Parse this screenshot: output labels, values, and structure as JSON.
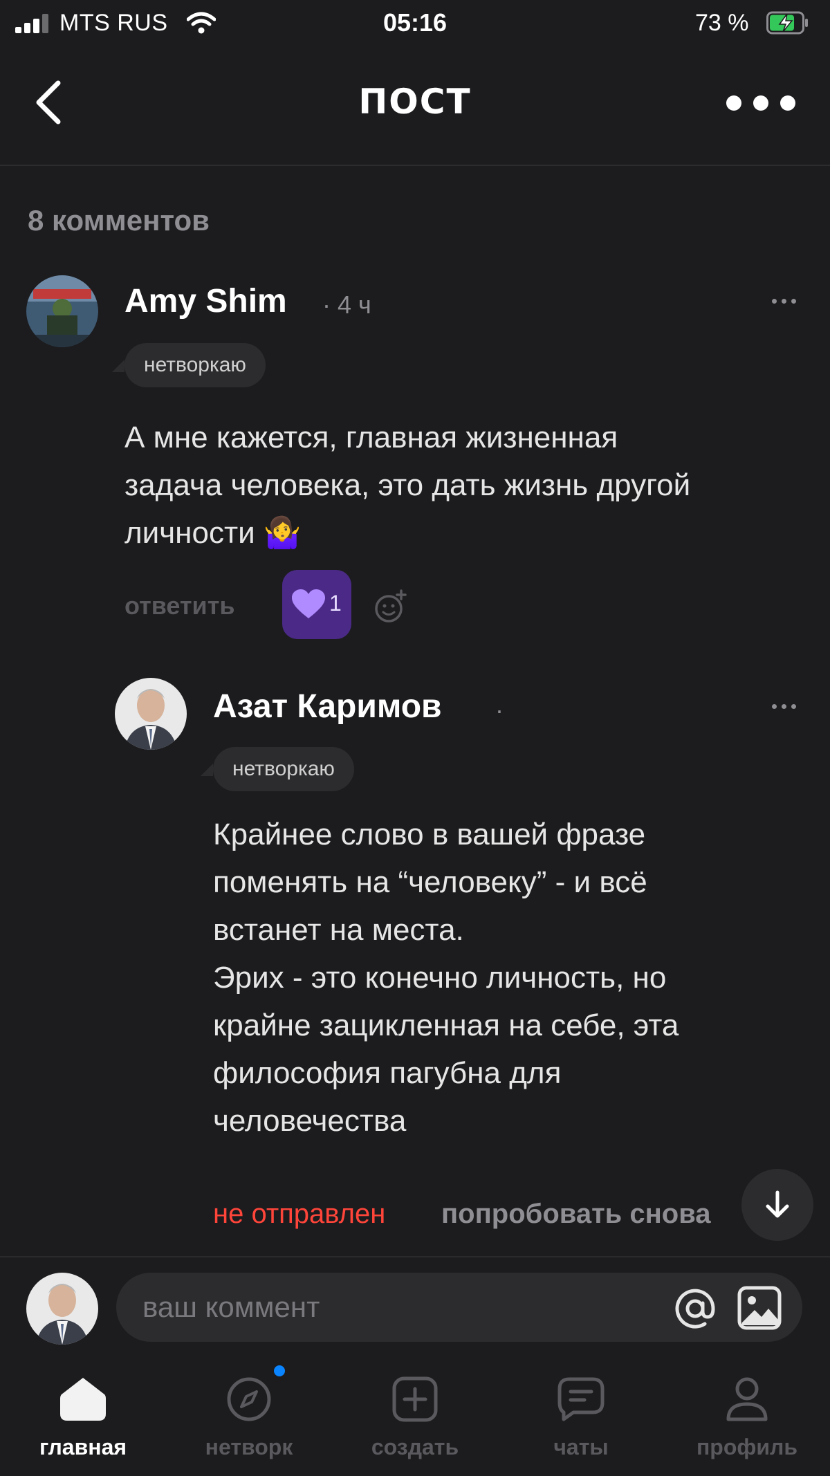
{
  "status_bar": {
    "carrier": "MTS RUS",
    "time": "05:16",
    "battery": "73 %"
  },
  "header": {
    "title": "ПОСТ"
  },
  "comments_count": "8 комментов",
  "comments": [
    {
      "author": "Amy Shim",
      "time": "· 4 ч",
      "tag": "нетворкаю",
      "text": "А мне кажется, главная жизненная\nзадача человека, это дать жизнь другой\nличности 🤷‍♀️",
      "reply_label": "ответить",
      "likes": "1"
    },
    {
      "author": "Азат Каримов",
      "time": "·",
      "tag": "нетворкаю",
      "text": "Крайнее слово в вашей фразе\nпоменять на “человеку” - и всё\nвстанет на места.\nЭрих - это конечно личность, но\nкрайне зацикленная на себе, эта\nфилософия пагубна для\nчеловечества",
      "status": "не отправлен",
      "retry_label": "попробовать снова"
    }
  ],
  "composer": {
    "placeholder": "ваш коммент"
  },
  "tabs": [
    {
      "label": "главная",
      "icon": "home-icon",
      "active": true
    },
    {
      "label": "нетворк",
      "icon": "compass-icon",
      "active": false
    },
    {
      "label": "создать",
      "icon": "plus-square-icon",
      "active": false
    },
    {
      "label": "чаты",
      "icon": "chat-icon",
      "active": false
    },
    {
      "label": "профиль",
      "icon": "person-icon",
      "active": false
    }
  ],
  "colors": {
    "background": "#1c1c1e",
    "accent_like": "#4a2a86",
    "error": "#ff453a",
    "notification": "#0a84ff"
  }
}
